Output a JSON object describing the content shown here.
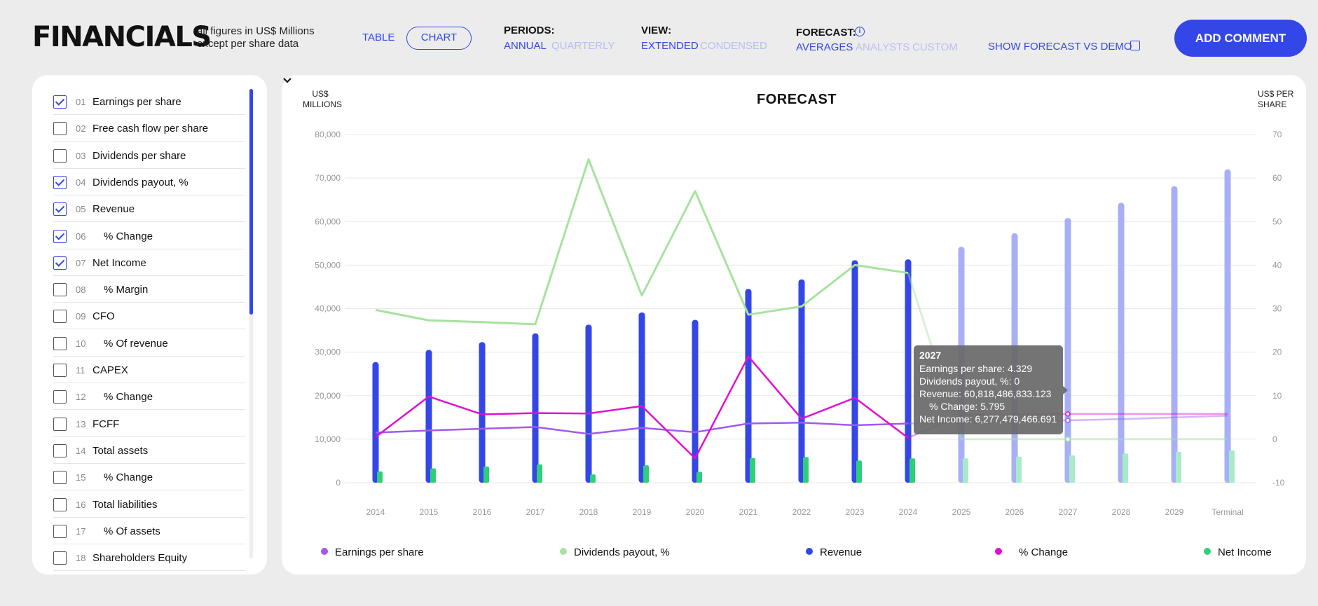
{
  "header": {
    "title": "FINANCIALS",
    "note_line1": "all figures in US$ Millions",
    "note_line2": "except per share data",
    "view_table": "TABLE",
    "view_chart": "CHART",
    "periods_label": "PERIODS:",
    "periods_annual": "ANNUAL",
    "periods_quarterly": "QUARTERLY",
    "view_label": "VIEW:",
    "view_extended": "EXTENDED",
    "view_condensed": "CONDENSED",
    "forecast_label": "FORECAST:",
    "forecast_averages": "AVERAGES",
    "forecast_analysts": "ANALYSTS",
    "forecast_custom": "CUSTOM",
    "show_forecast": "SHOW FORECAST VS DEMO",
    "add_comment": "ADD COMMENT"
  },
  "metrics": [
    {
      "num": "01",
      "label": "Earnings per share",
      "checked": true,
      "sub": false
    },
    {
      "num": "02",
      "label": "Free cash flow per share",
      "checked": false,
      "sub": false
    },
    {
      "num": "03",
      "label": "Dividends per share",
      "checked": false,
      "sub": false
    },
    {
      "num": "04",
      "label": "Dividends payout, %",
      "checked": true,
      "sub": false
    },
    {
      "num": "05",
      "label": "Revenue",
      "checked": true,
      "sub": false
    },
    {
      "num": "06",
      "label": "% Change",
      "checked": true,
      "sub": true
    },
    {
      "num": "07",
      "label": "Net Income",
      "checked": true,
      "sub": false
    },
    {
      "num": "08",
      "label": "% Margin",
      "checked": false,
      "sub": true
    },
    {
      "num": "09",
      "label": "CFO",
      "checked": false,
      "sub": false
    },
    {
      "num": "10",
      "label": "% Of revenue",
      "checked": false,
      "sub": true
    },
    {
      "num": "11",
      "label": "CAPEX",
      "checked": false,
      "sub": false
    },
    {
      "num": "12",
      "label": "% Change",
      "checked": false,
      "sub": true
    },
    {
      "num": "13",
      "label": "FCFF",
      "checked": false,
      "sub": false
    },
    {
      "num": "14",
      "label": "Total assets",
      "checked": false,
      "sub": false
    },
    {
      "num": "15",
      "label": "% Change",
      "checked": false,
      "sub": true
    },
    {
      "num": "16",
      "label": "Total liabilities",
      "checked": false,
      "sub": false
    },
    {
      "num": "17",
      "label": "% Of assets",
      "checked": false,
      "sub": true
    },
    {
      "num": "18",
      "label": "Shareholders Equity",
      "checked": false,
      "sub": false
    }
  ],
  "chart": {
    "title": "FORECAST",
    "left_unit_1": "US$",
    "left_unit_2": "MILLIONS",
    "right_unit_1": "US$ PER",
    "right_unit_2": "SHARE",
    "tooltip": {
      "title": "2027",
      "line1": "Earnings per share: 4.329",
      "line2": "Dividends payout, %: 0",
      "line3": "Revenue: 60,818,486,833.123",
      "line4": "% Change: 5.795",
      "line5": "Net Income: 6,277,479,466.691"
    }
  },
  "colors": {
    "revenue": "#3347e8",
    "revenue_forecast": "#a7b0f5",
    "net_income": "#2fcf78",
    "net_income_forecast": "#a9ebc7",
    "eps": "#a259f0",
    "dividends_payout": "#a6e39e",
    "pct_change": "#e010d0",
    "accent": "#3347e8"
  },
  "chart_data": {
    "type": "bar",
    "title": "FORECAST",
    "categories": [
      "2014",
      "2015",
      "2016",
      "2017",
      "2018",
      "2019",
      "2020",
      "2021",
      "2022",
      "2023",
      "2024",
      "2025",
      "2026",
      "2027",
      "2028",
      "2029",
      "Terminal"
    ],
    "forecast_start_index": 11,
    "y_left": {
      "label": "US$ MILLIONS",
      "ticks": [
        "80,000",
        "70,000",
        "60,000",
        "50,000",
        "40,000",
        "30,000",
        "20,000",
        "10,000",
        "0"
      ],
      "ylim": [
        0,
        80000
      ]
    },
    "y_right": {
      "label": "US$ PER SHARE",
      "ticks": [
        "70",
        "60",
        "50",
        "40",
        "30",
        "20",
        "10",
        "0",
        "-10"
      ],
      "ylim": [
        -10,
        70
      ]
    },
    "grid": true,
    "legend_position": "bottom",
    "series": [
      {
        "name": "Revenue",
        "kind": "bar",
        "axis": "left",
        "values": [
          27700,
          30500,
          32300,
          34300,
          36300,
          39100,
          37400,
          44500,
          46700,
          51100,
          51300,
          54200,
          57300,
          60800,
          64300,
          68100,
          72000
        ]
      },
      {
        "name": "Net Income",
        "kind": "bar",
        "axis": "left",
        "values": [
          2600,
          3300,
          3700,
          4200,
          1900,
          4000,
          2500,
          5700,
          5900,
          5100,
          5600,
          5600,
          6000,
          6277,
          6700,
          7100,
          7400
        ]
      },
      {
        "name": "Earnings per share",
        "kind": "line",
        "axis": "right",
        "values": [
          1.5,
          2.0,
          2.4,
          2.8,
          1.2,
          2.6,
          1.6,
          3.6,
          3.8,
          3.2,
          3.6,
          3.7,
          4.0,
          4.329,
          4.6,
          5.0,
          5.4
        ]
      },
      {
        "name": "Dividends payout, %",
        "kind": "line",
        "axis": "right",
        "values": [
          29.7,
          27.3,
          26.9,
          26.4,
          64.3,
          33.0,
          57.0,
          28.6,
          30.5,
          40.0,
          38.2,
          0,
          0,
          0,
          0,
          0,
          0
        ]
      },
      {
        "name": "% Change",
        "kind": "line",
        "axis": "right",
        "values": [
          0.5,
          9.8,
          5.7,
          6.0,
          5.9,
          7.6,
          -4.4,
          19.0,
          4.7,
          9.5,
          0.3,
          5.6,
          5.7,
          5.795,
          5.8,
          5.8,
          5.8
        ]
      }
    ]
  }
}
